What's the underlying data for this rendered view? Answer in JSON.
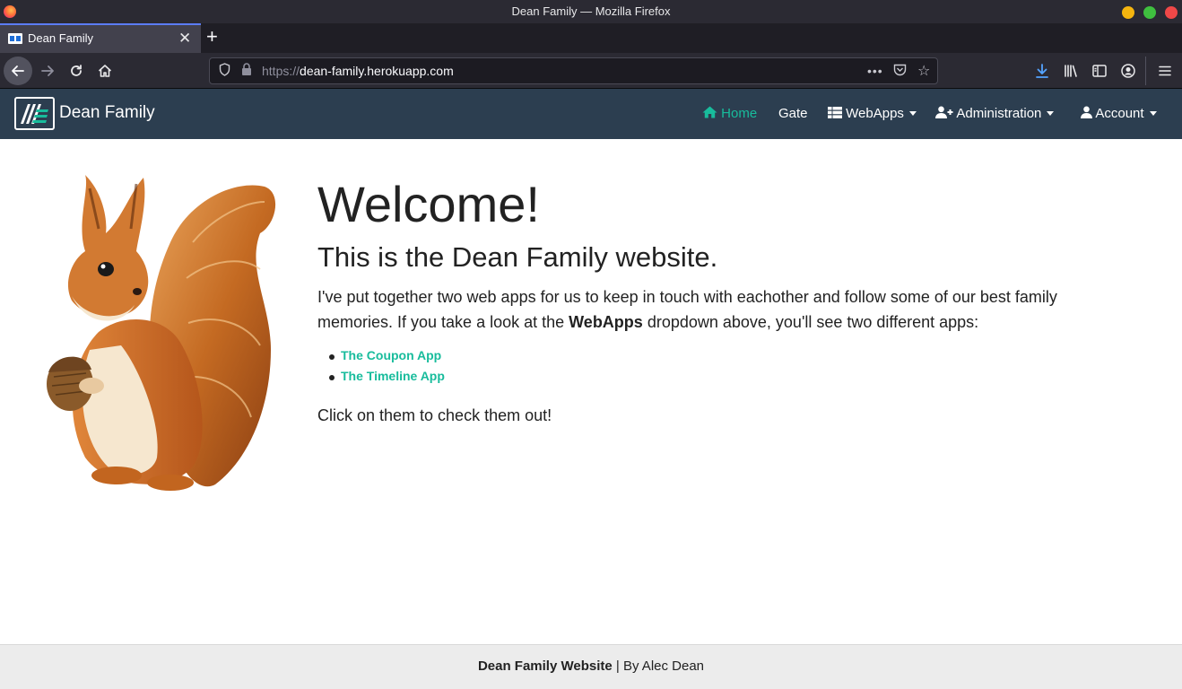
{
  "window": {
    "title": "Dean Family — Mozilla Firefox"
  },
  "tab": {
    "label": "Dean Family",
    "close_glyph": "✕",
    "new_tab_glyph": "+"
  },
  "toolbar": {
    "url_protocol": "https://",
    "url_host": "dean-family.herokuapp.com"
  },
  "navbar": {
    "brand": "Dean Family",
    "items": [
      {
        "label": "Home",
        "icon": "home-icon",
        "active": true
      },
      {
        "label": "Gate",
        "icon": null
      },
      {
        "label": "WebApps",
        "icon": "table-icon",
        "dropdown": true
      },
      {
        "label": "Administration",
        "icon": "user-plus-icon",
        "dropdown": true
      },
      {
        "label": "Account",
        "icon": "user-icon",
        "dropdown": true
      }
    ]
  },
  "main": {
    "heading": "Welcome!",
    "subheading": "This is the Dean Family website.",
    "intro_before": "I've put together two web apps for us to keep in touch with eachother and follow some of our best family memories. If you take a look at the ",
    "intro_bold": "WebApps",
    "intro_after": " dropdown above, you'll see two different apps:",
    "apps": [
      "The Coupon App",
      "The Timeline App"
    ],
    "outro": "Click on them to check them out!"
  },
  "footer": {
    "bold": "Dean Family Website",
    "rest": " | By Alec Dean"
  },
  "colors": {
    "navbar_bg": "#2c3e50",
    "accent": "#18bc9c",
    "footer_bg": "#ececec"
  }
}
